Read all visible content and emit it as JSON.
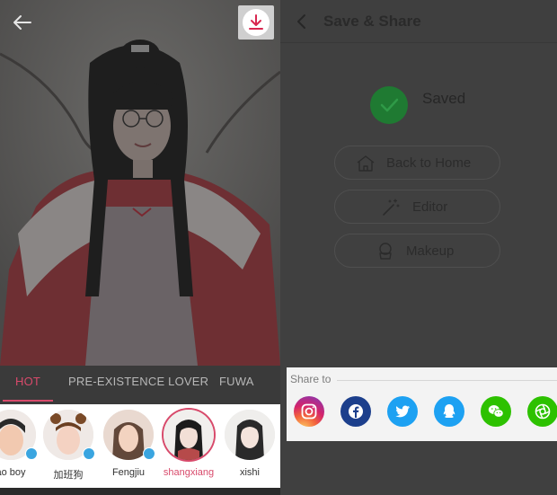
{
  "editor": {
    "tabs": [
      {
        "label": "HOT",
        "active": true
      },
      {
        "label": "PRE-EXISTENCE LOVER",
        "active": false
      },
      {
        "label": "FUWA",
        "active": false
      }
    ],
    "styles": [
      {
        "label": "ao boy",
        "downloadable": true,
        "selected": false
      },
      {
        "label": "加班狗",
        "downloadable": true,
        "selected": false
      },
      {
        "label": "Fengjiu",
        "downloadable": true,
        "selected": false
      },
      {
        "label": "shangxiang",
        "downloadable": false,
        "selected": true
      },
      {
        "label": "xishi",
        "downloadable": false,
        "selected": false
      }
    ],
    "accent_color": "#d84a6b"
  },
  "save_share": {
    "title": "Save & Share",
    "status": "Saved",
    "actions": [
      {
        "label": "Back to Home",
        "icon": "home-icon"
      },
      {
        "label": "Editor",
        "icon": "magic-wand-icon"
      },
      {
        "label": "Makeup",
        "icon": "makeup-icon"
      }
    ],
    "share_label": "Share to",
    "share_targets": [
      {
        "name": "instagram",
        "color": "#c13584"
      },
      {
        "name": "facebook",
        "color": "#1c3f8c"
      },
      {
        "name": "twitter",
        "color": "#1da1f2"
      },
      {
        "name": "qq",
        "color": "#1da1f2"
      },
      {
        "name": "wechat",
        "color": "#2dc100"
      },
      {
        "name": "moments",
        "color": "#2dc100"
      }
    ]
  }
}
